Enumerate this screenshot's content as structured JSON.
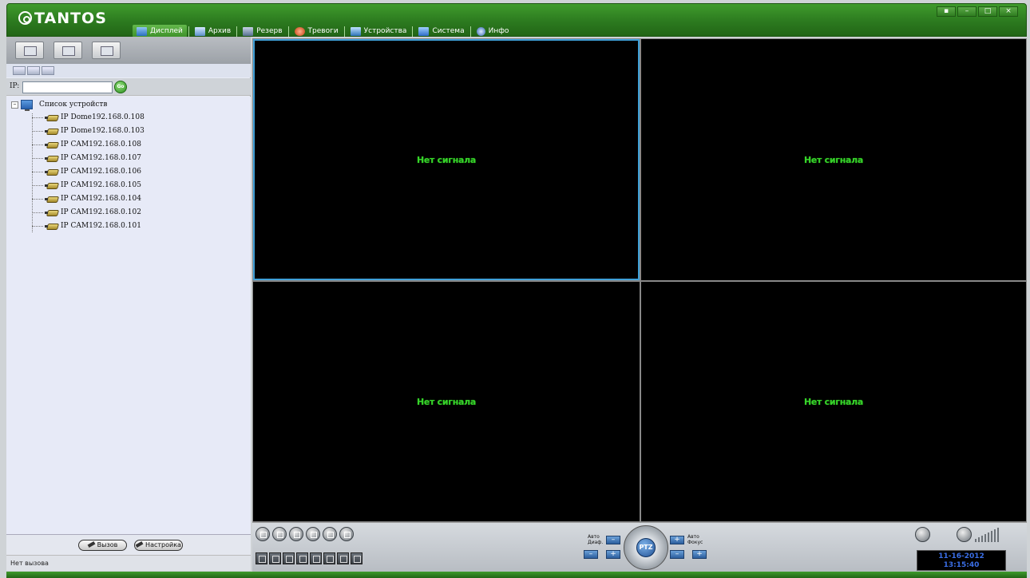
{
  "app": {
    "logo_text": "TANTOS"
  },
  "menu": [
    {
      "label": "Дисплей",
      "icon": "display-icon",
      "active": true
    },
    {
      "label": "Архив",
      "icon": "archive-icon",
      "active": false
    },
    {
      "label": "Резерв",
      "icon": "backup-icon",
      "active": false
    },
    {
      "label": "Тревоги",
      "icon": "alarm-icon",
      "active": false
    },
    {
      "label": "Устройства",
      "icon": "devices-icon",
      "active": false
    },
    {
      "label": "Система",
      "icon": "system-icon",
      "active": false
    },
    {
      "label": "Инфо",
      "icon": "info-icon",
      "active": false
    }
  ],
  "window_controls": {
    "menu": "▪",
    "minimize": "–",
    "restore": "□",
    "close": "×"
  },
  "ip_search": {
    "label": "IP:",
    "value": "",
    "go_label": "Go"
  },
  "device_tree": {
    "root_label": "Список устройств",
    "toggle": "–",
    "devices": [
      "IP Dome192.168.0.108",
      "IP Dome192.168.0.103",
      "IP CAM192.168.0.108",
      "IP CAM192.168.0.107",
      "IP CAM192.168.0.106",
      "IP CAM192.168.0.105",
      "IP CAM192.168.0.104",
      "IP CAM192.168.0.102",
      "IP CAM192.168.0.101"
    ]
  },
  "left_bottom": {
    "call_label": "Вызов",
    "settings_label": "Настройка",
    "status": "Нет вызова"
  },
  "video": {
    "no_signal": [
      "Нет сигнала",
      "Нет сигнала",
      "Нет сигнала",
      "Нет сигнала"
    ],
    "selected_cell": 0
  },
  "ptz": {
    "center_label": "PTZ",
    "auto_iris": "Авто Диаф.",
    "auto_focus": "Авто Фокус",
    "minus": "–",
    "plus": "+"
  },
  "clock": {
    "date": "11-16-2012",
    "time": "13:15:40"
  },
  "colors": {
    "accent_green": "#2c7a1f",
    "no_signal_text": "#37d42a",
    "selected_border": "#3fa0d8"
  }
}
